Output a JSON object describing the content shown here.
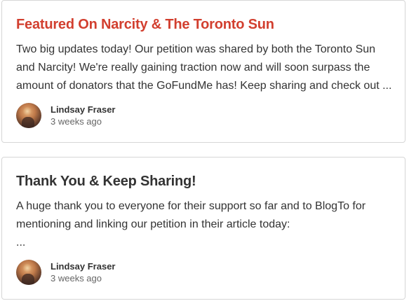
{
  "updates": [
    {
      "title": "Featured On Narcity & The Toronto Sun",
      "title_color": "#d23f2f",
      "body_lines": [
        "Two big updates today! Our petition was shared by both the Toronto Sun",
        "and Narcity! We're really gaining traction now and will soon surpass the",
        "amount of donators that the GoFundMe has! Keep sharing and check out ..."
      ],
      "author": {
        "name": "Lindsay Fraser",
        "time": "3 weeks ago"
      }
    },
    {
      "title": "Thank You & Keep Sharing!",
      "title_color": "#333333",
      "body_lines": [
        "A huge thank you to everyone for their support so far and to BlogTo for",
        "mentioning and linking our petition in their article today:",
        "..."
      ],
      "author": {
        "name": "Lindsay Fraser",
        "time": "3 weeks ago"
      }
    }
  ]
}
